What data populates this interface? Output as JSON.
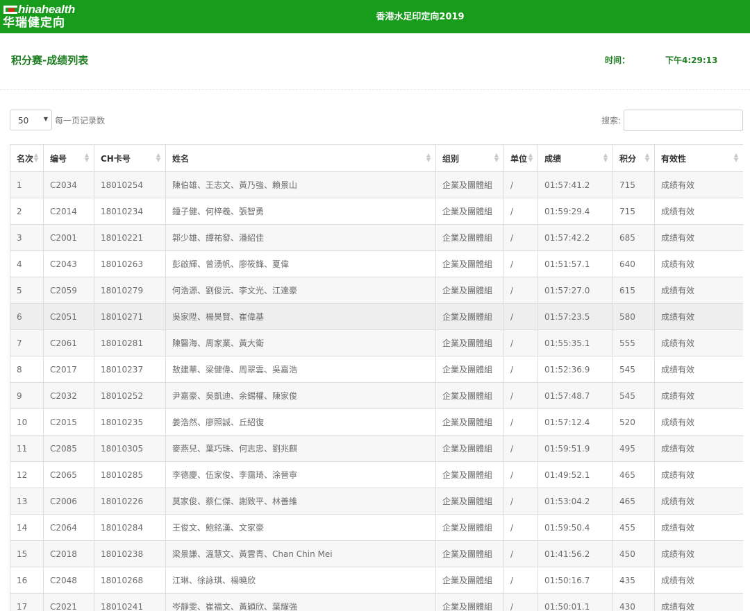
{
  "header": {
    "logo_latin": "Chinahealth",
    "logo_latin_tail": "hinahealth",
    "logo_chinese": "华瑞健定向",
    "event_title": "香港水足印定向2019"
  },
  "page": {
    "title": "积分赛-成绩列表",
    "time_label": "时间：",
    "time_value": "下午4:29:13"
  },
  "controls": {
    "page_length": "50",
    "page_length_label": "每一页记录数",
    "search_label": "搜索:",
    "search_value": ""
  },
  "colors": {
    "brand_green": "#189c1c",
    "title_green": "#1f7d22"
  },
  "icons": {
    "sort": "sort-arrows-icon",
    "dropdown": "caret-down-icon"
  },
  "table": {
    "columns": [
      "名次",
      "编号",
      "CH卡号",
      "姓名",
      "组别",
      "单位",
      "成绩",
      "积分",
      "有效性"
    ],
    "rows": [
      [
        "1",
        "C2034",
        "18010254",
        "陳伯雄、王志文、黃乃強、賴景山",
        "企業及團體組",
        "/",
        "01:57:41.2",
        "715",
        "成绩有效"
      ],
      [
        "2",
        "C2014",
        "18010234",
        "鍾子健、何梓羲、張智勇",
        "企業及團體組",
        "/",
        "01:59:29.4",
        "715",
        "成绩有效"
      ],
      [
        "3",
        "C2001",
        "18010221",
        "郭少雄、譚祐發、潘紹佳",
        "企業及團體組",
        "/",
        "01:57:42.2",
        "685",
        "成绩有效"
      ],
      [
        "4",
        "C2043",
        "18010263",
        "彭啟輝、曾湧帆、廖筱鋒、夏偉",
        "企業及團體組",
        "/",
        "01:51:57.1",
        "640",
        "成绩有效"
      ],
      [
        "5",
        "C2059",
        "18010279",
        "何浩源、劉俊沅、李文光、江達豪",
        "企業及團體組",
        "/",
        "01:57:27.0",
        "615",
        "成绩有效"
      ],
      [
        "6",
        "C2051",
        "18010271",
        "吳家陞、楊昊賢、崔偉基",
        "企業及團體組",
        "/",
        "01:57:23.5",
        "580",
        "成绩有效"
      ],
      [
        "7",
        "C2061",
        "18010281",
        "陳醫海、周家業、黃大衛",
        "企業及團體組",
        "/",
        "01:55:35.1",
        "555",
        "成绩有效"
      ],
      [
        "8",
        "C2017",
        "18010237",
        "敖建華、梁健偉、周翠雲、吳嘉浩",
        "企業及團體組",
        "/",
        "01:52:36.9",
        "545",
        "成绩有效"
      ],
      [
        "9",
        "C2032",
        "18010252",
        "尹嘉豪、吳凱迪、余錫權、陳家俊",
        "企業及團體組",
        "/",
        "01:57:48.7",
        "545",
        "成绩有效"
      ],
      [
        "10",
        "C2015",
        "18010235",
        "姜浩然、廖照誠、丘紹復",
        "企業及團體組",
        "/",
        "01:57:12.4",
        "520",
        "成绩有效"
      ],
      [
        "11",
        "C2085",
        "18010305",
        "麥燕兒、葉巧珠、何志忠、劉兆麒",
        "企業及團體組",
        "/",
        "01:59:51.9",
        "495",
        "成绩有效"
      ],
      [
        "12",
        "C2065",
        "18010285",
        "李德慶、伍家俊、李靄琦、涂晉寧",
        "企業及團體組",
        "/",
        "01:49:52.1",
        "465",
        "成绩有效"
      ],
      [
        "13",
        "C2006",
        "18010226",
        "莫家俊、蔡仁傑、謝致平、林善維",
        "企業及團體組",
        "/",
        "01:53:04.2",
        "465",
        "成绩有效"
      ],
      [
        "14",
        "C2064",
        "18010284",
        "王俊文、鮑銘漢、文家豪",
        "企業及團體組",
        "/",
        "01:59:50.4",
        "455",
        "成绩有效"
      ],
      [
        "15",
        "C2018",
        "18010238",
        "梁景謙、溫慧文、黃雲青、Chan Chin Mei",
        "企業及團體組",
        "/",
        "01:41:56.2",
        "450",
        "成绩有效"
      ],
      [
        "16",
        "C2048",
        "18010268",
        "江琳、徐詠琪、楊曉欣",
        "企業及團體組",
        "/",
        "01:50:16.7",
        "435",
        "成绩有效"
      ],
      [
        "17",
        "C2021",
        "18010241",
        "岑靜雯、崔福文、黃穎欣、葉耀強",
        "企業及團體組",
        "/",
        "01:50:01.1",
        "430",
        "成绩有效"
      ]
    ]
  }
}
